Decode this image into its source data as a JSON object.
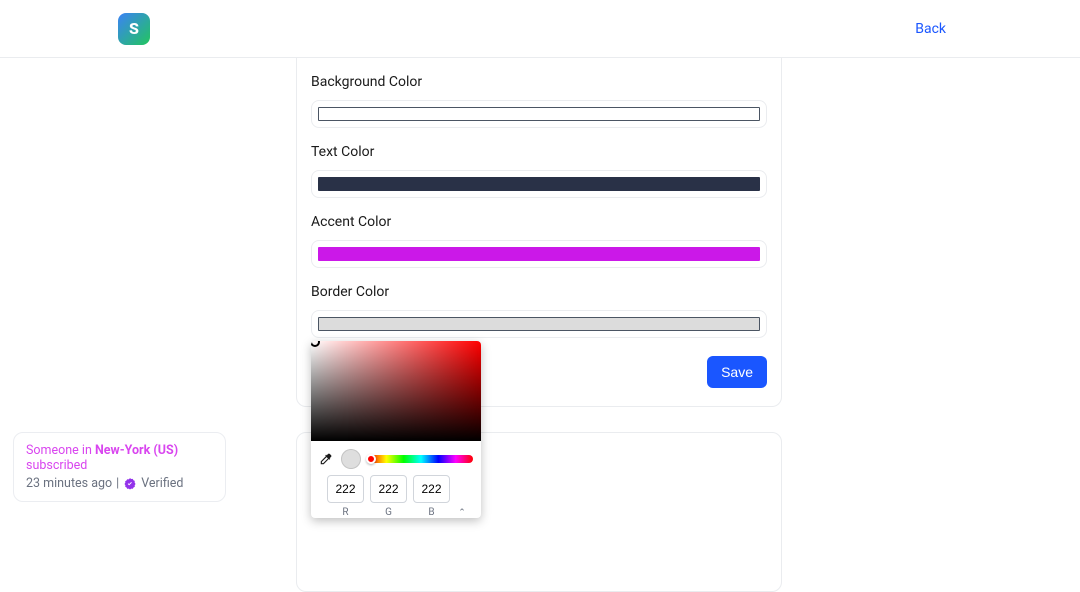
{
  "header": {
    "back_label": "Back",
    "logo_letter": "S"
  },
  "form": {
    "fields": [
      {
        "label": "Background Color",
        "value": "#ffffff",
        "bordered": true
      },
      {
        "label": "Text Color",
        "value": "#293147",
        "bordered": false
      },
      {
        "label": "Accent Color",
        "value": "#cb18e8",
        "bordered": false
      },
      {
        "label": "Border Color",
        "value": "#dcdcdc",
        "bordered": true
      }
    ],
    "save_label": "Save"
  },
  "color_picker": {
    "current_swatch": "#dedede",
    "rgb": {
      "r": "222",
      "g": "222",
      "b": "222"
    },
    "labels": {
      "r": "R",
      "g": "G",
      "b": "B"
    }
  },
  "toast": {
    "prefix": "Someone in ",
    "location": "New-York (US)",
    "suffix": " subscribed",
    "time": "23 minutes ago",
    "separator": "|",
    "verified_label": "Verified"
  },
  "colors": {
    "accent_blue": "#1a56ff",
    "accent_magenta": "#d946ef"
  }
}
